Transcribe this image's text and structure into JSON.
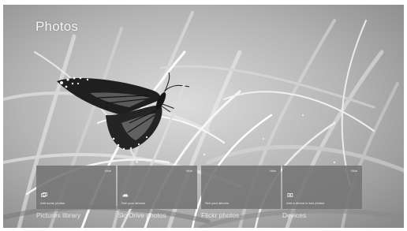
{
  "app": {
    "title": "Photos"
  },
  "tiles": [
    {
      "label": "Pictures library",
      "description": "Add some photos",
      "hide_label": "Hide",
      "icon": "pictures-library-icon"
    },
    {
      "label": "SkyDrive photos",
      "description": "See your albums",
      "hide_label": "Hide",
      "icon": "skydrive-icon"
    },
    {
      "label": "Flickr photos",
      "description": "See your albums",
      "hide_label": "Hide",
      "icon": "none"
    },
    {
      "label": "Devices",
      "description": "Add a device to see photos",
      "hide_label": "Hide",
      "icon": "device-icon"
    }
  ],
  "colors": {
    "tile_background": "#747474",
    "text": "#f4f4f4"
  }
}
